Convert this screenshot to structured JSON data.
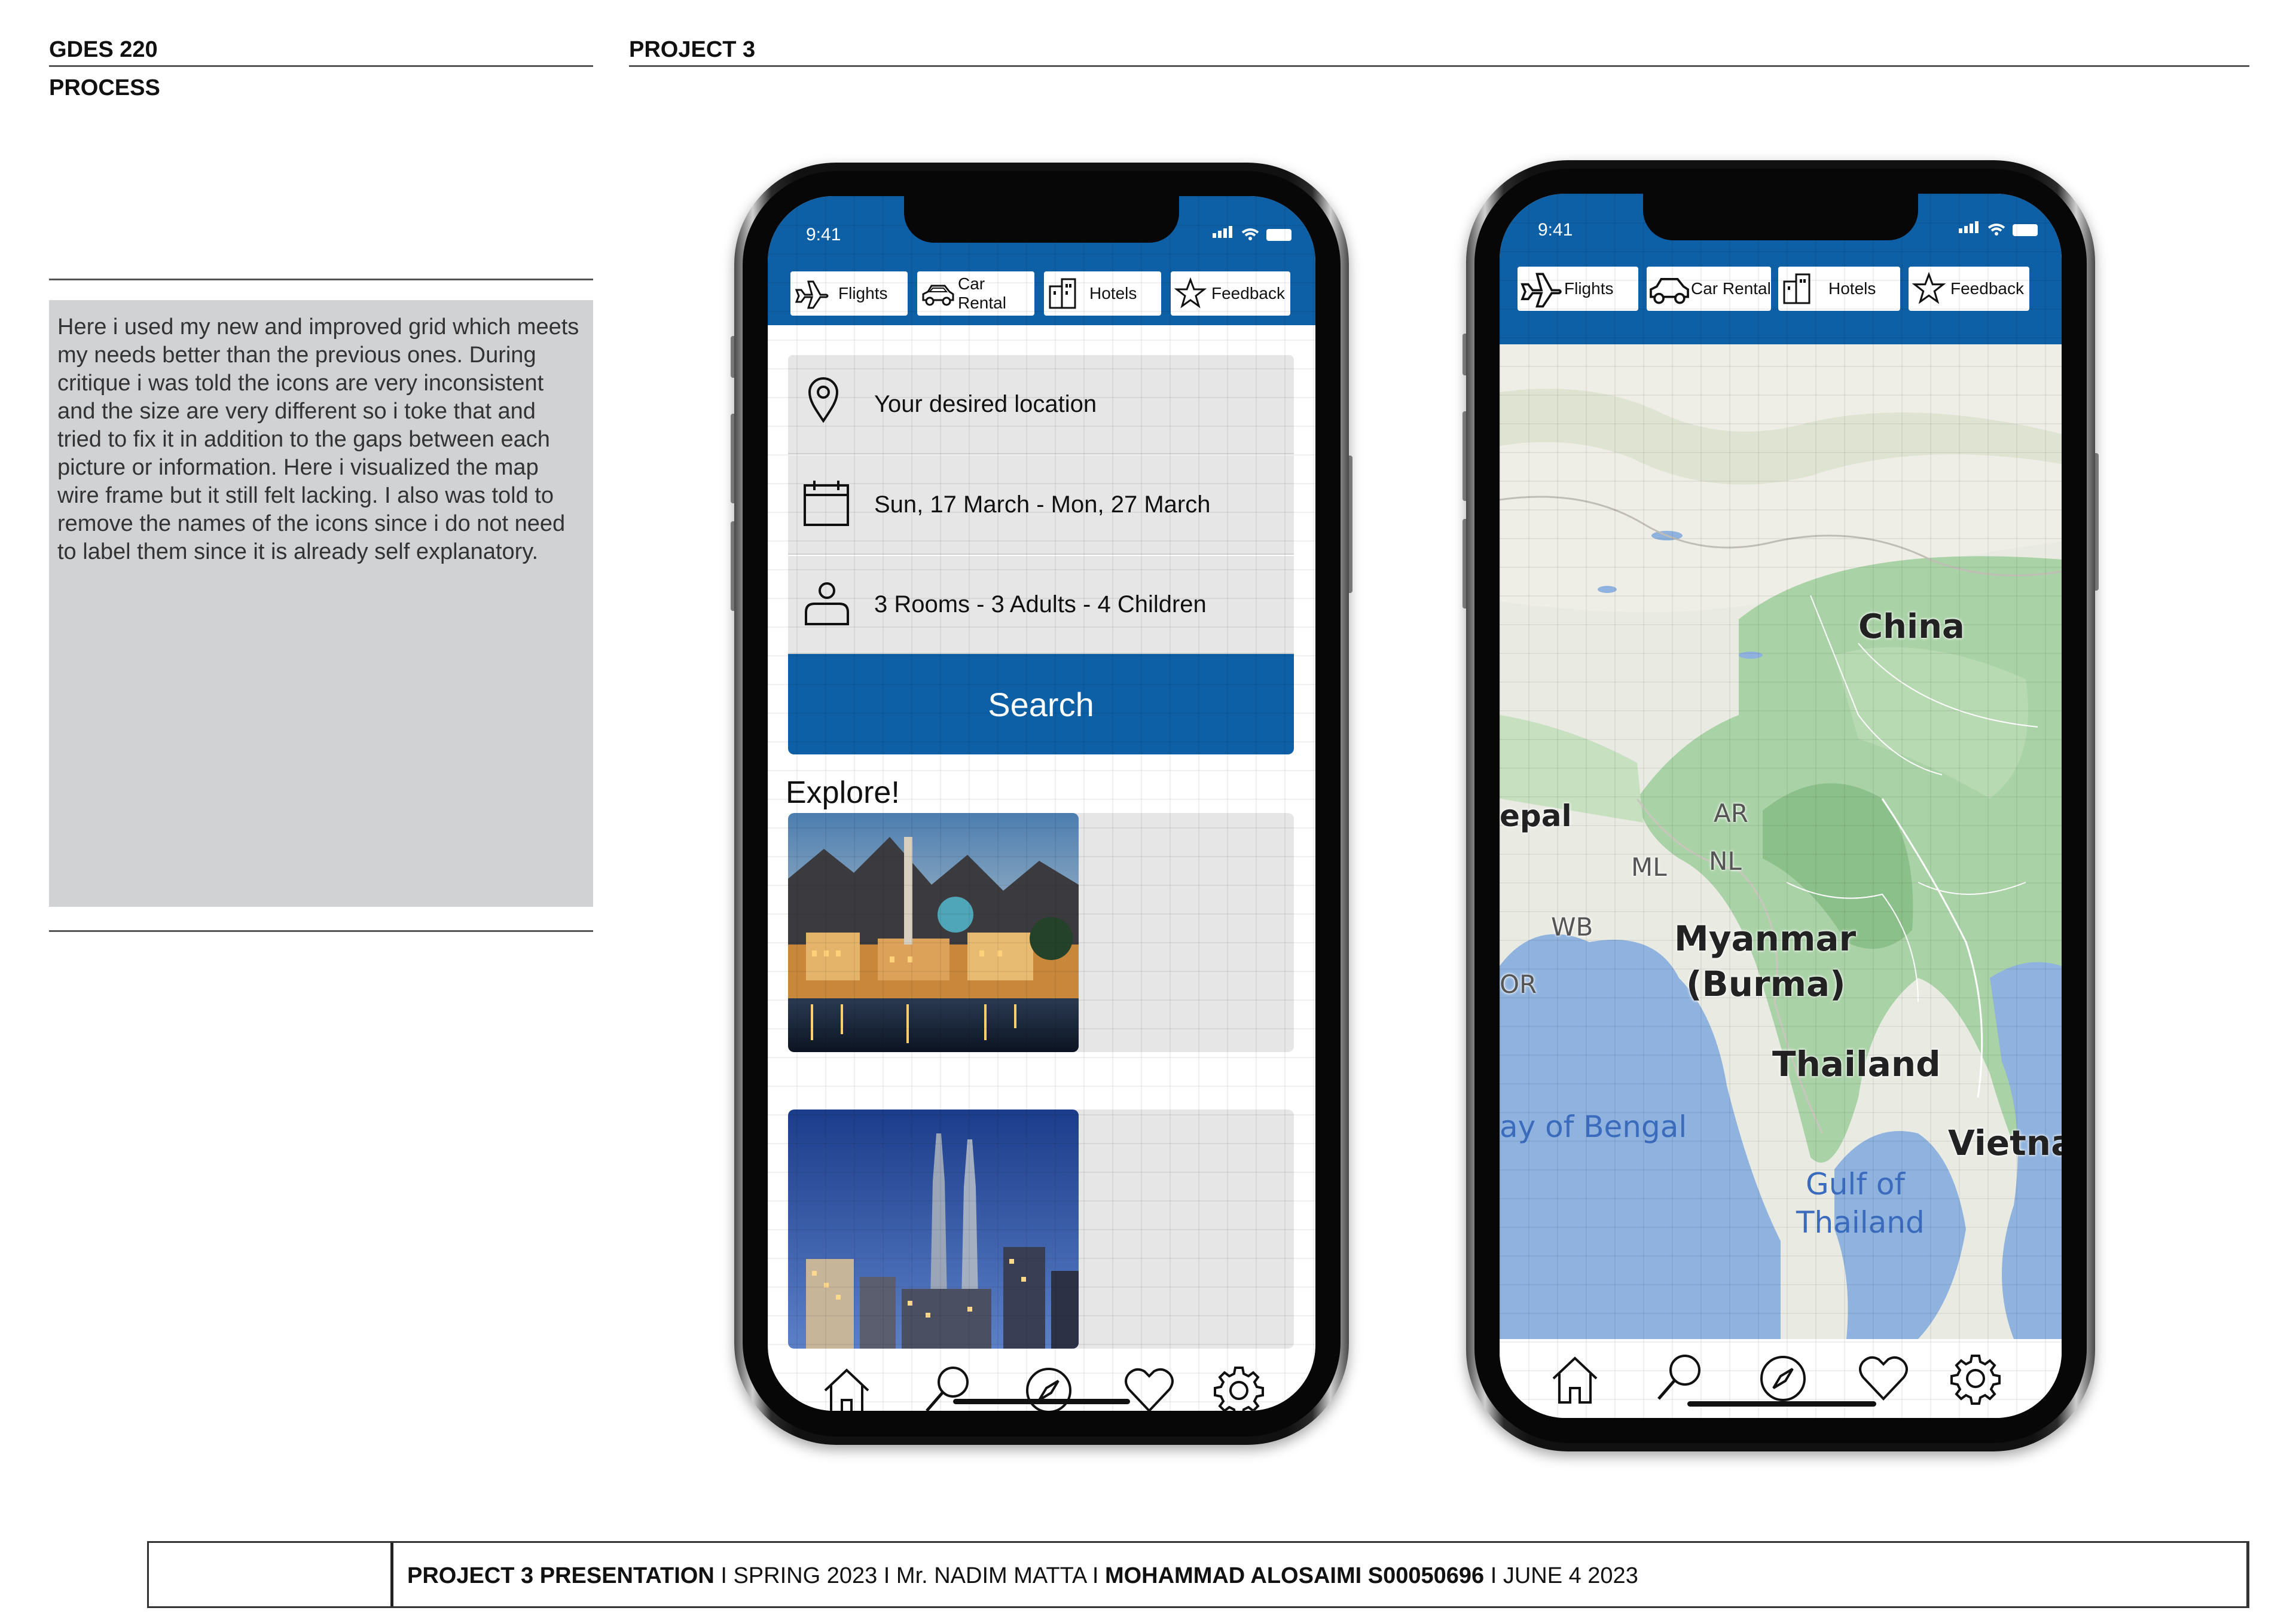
{
  "header": {
    "course": "GDES 220",
    "section": "PROCESS",
    "project": "PROJECT 3"
  },
  "description": "Here i used my new and improved grid which meets my needs better than the previous ones. During critique i was told the icons are very inconsistent and the size are very different so i toke that and tried to fix it in addition to the gaps between each picture or information. Here i visualized the map wire frame but it still felt lacking. I also was told to remove the names of the icons since i do not need to label them since it is already self explanatory.",
  "phone_left": {
    "time": "9:41",
    "tabs": [
      {
        "label": "Flights",
        "icon": "airplane-icon"
      },
      {
        "label": "Car Rental",
        "icon": "car-icon"
      },
      {
        "label": "Hotels",
        "icon": "building-icon"
      },
      {
        "label": "Feedback",
        "icon": "star-icon"
      }
    ],
    "location": "Your desired location",
    "dates": "Sun, 17 March - Mon, 27 March",
    "guests": "3 Rooms - 3 Adults - 4 Children",
    "search_label": "Search",
    "explore_title": "Explore!",
    "cards": [
      {
        "image": "muscat-corniche-photo"
      },
      {
        "image": "kuala-lumpur-towers-photo"
      }
    ]
  },
  "phone_right": {
    "time": "9:41",
    "tabs": [
      {
        "label": "Flights",
        "icon": "airplane-icon"
      },
      {
        "label": "Car Rental",
        "icon": "car-icon"
      },
      {
        "label": "Hotels",
        "icon": "building-icon"
      },
      {
        "label": "Feedback",
        "icon": "star-icon"
      }
    ],
    "map_labels": {
      "china": "China",
      "nepal": "epal",
      "ar": "AR",
      "ml": "ML",
      "nl": "NL",
      "wb": "WB",
      "myanmar": "Myanmar",
      "burma": "(Burma)",
      "or": "OR",
      "thailand": "Thailand",
      "bay": "ay of Bengal",
      "vietnam": "Vietna",
      "gulf1": "Gulf of",
      "gulf2": "Thailand"
    }
  },
  "bottom_nav": [
    "home-icon",
    "search-icon",
    "compass-icon",
    "heart-icon",
    "gear-icon"
  ],
  "footer": {
    "part1": "PROJECT 3 PRESENTATION",
    "part2": " I SPRING 2023 I Mr. NADIM MATTA I ",
    "part3": "MOHAMMAD ALOSAIMI S00050696",
    "part4": " I JUNE 4 2023"
  },
  "colors": {
    "brand_blue": "#0d5fa6",
    "field_gray": "#e6e6e7",
    "desc_bg": "#d1d2d4",
    "map_water": "#8fb3de",
    "map_land": "#e9ebe3",
    "map_forest": "#9cc79a"
  }
}
